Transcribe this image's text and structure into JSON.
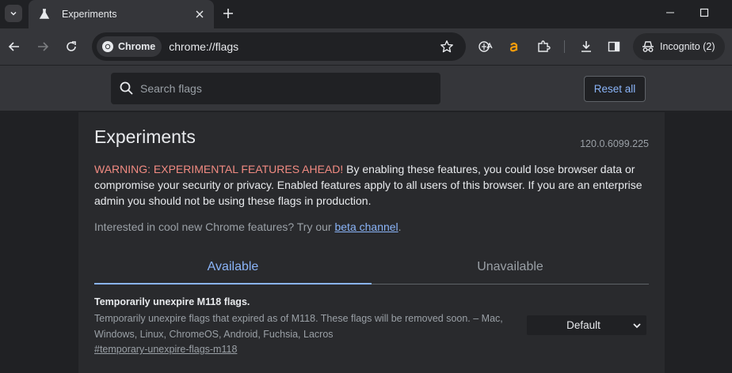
{
  "tab": {
    "title": "Experiments",
    "favicon": "flask-icon"
  },
  "omnibox": {
    "chip_label": "Chrome",
    "url": "chrome://flags"
  },
  "profile": {
    "label": "Incognito (2)"
  },
  "header": {
    "search_placeholder": "Search flags",
    "reset_label": "Reset all"
  },
  "page": {
    "title": "Experiments",
    "version": "120.0.6099.225",
    "warning_prefix": "WARNING: EXPERIMENTAL FEATURES AHEAD!",
    "warning_body": " By enabling these features, you could lose browser data or compromise your security or privacy. Enabled features apply to all users of this browser. If you are an enterprise admin you should not be using these flags in production.",
    "interest_text": "Interested in cool new Chrome features? Try our ",
    "interest_link": "beta channel",
    "interest_end": ".",
    "tabs": [
      {
        "label": "Available",
        "active": true
      },
      {
        "label": "Unavailable",
        "active": false
      }
    ]
  },
  "flags": [
    {
      "title": "Temporarily unexpire M118 flags.",
      "description": "Temporarily unexpire flags that expired as of M118. These flags will be removed soon. – Mac, Windows, Linux, ChromeOS, Android, Fuchsia, Lacros",
      "link": "#temporary-unexpire-flags-m118",
      "selected_option": "Default"
    }
  ],
  "colors": {
    "accent": "#8ab4f8",
    "warning": "#f28b82",
    "background": "#202124",
    "surface": "#292a2d"
  }
}
